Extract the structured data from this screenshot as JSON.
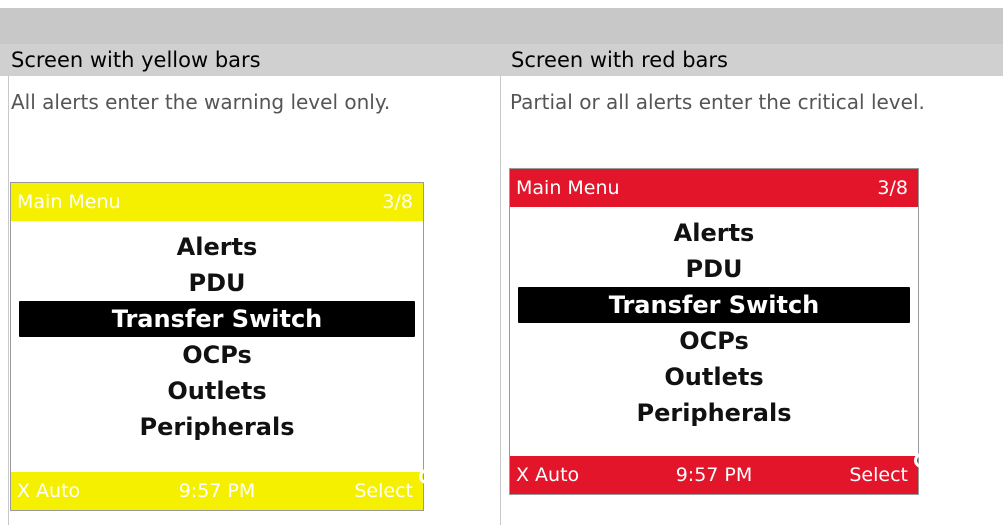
{
  "headers": {
    "left": "Screen with yellow bars",
    "right": "Screen with red bars"
  },
  "descriptions": {
    "left": "All alerts enter the warning level only.",
    "right": "Partial or all alerts enter the critical level."
  },
  "screens": {
    "yellow": {
      "bar_color": "#f5f000",
      "title": "Main  Menu",
      "page": "3/8",
      "items": [
        "Alerts",
        "PDU",
        "Transfer Switch",
        "OCPs",
        "Outlets",
        "Peripherals"
      ],
      "selected_index": 2,
      "footer_left": "X Auto",
      "footer_time": "9:57 PM",
      "footer_right": "Select"
    },
    "red": {
      "bar_color": "#e2152a",
      "title": "Main  Menu",
      "page": "3/8",
      "items": [
        "Alerts",
        "PDU",
        "Transfer Switch",
        "OCPs",
        "Outlets",
        "Peripherals"
      ],
      "selected_index": 2,
      "footer_left": "X Auto",
      "footer_time": "9:57 PM",
      "footer_right": "Select"
    }
  }
}
